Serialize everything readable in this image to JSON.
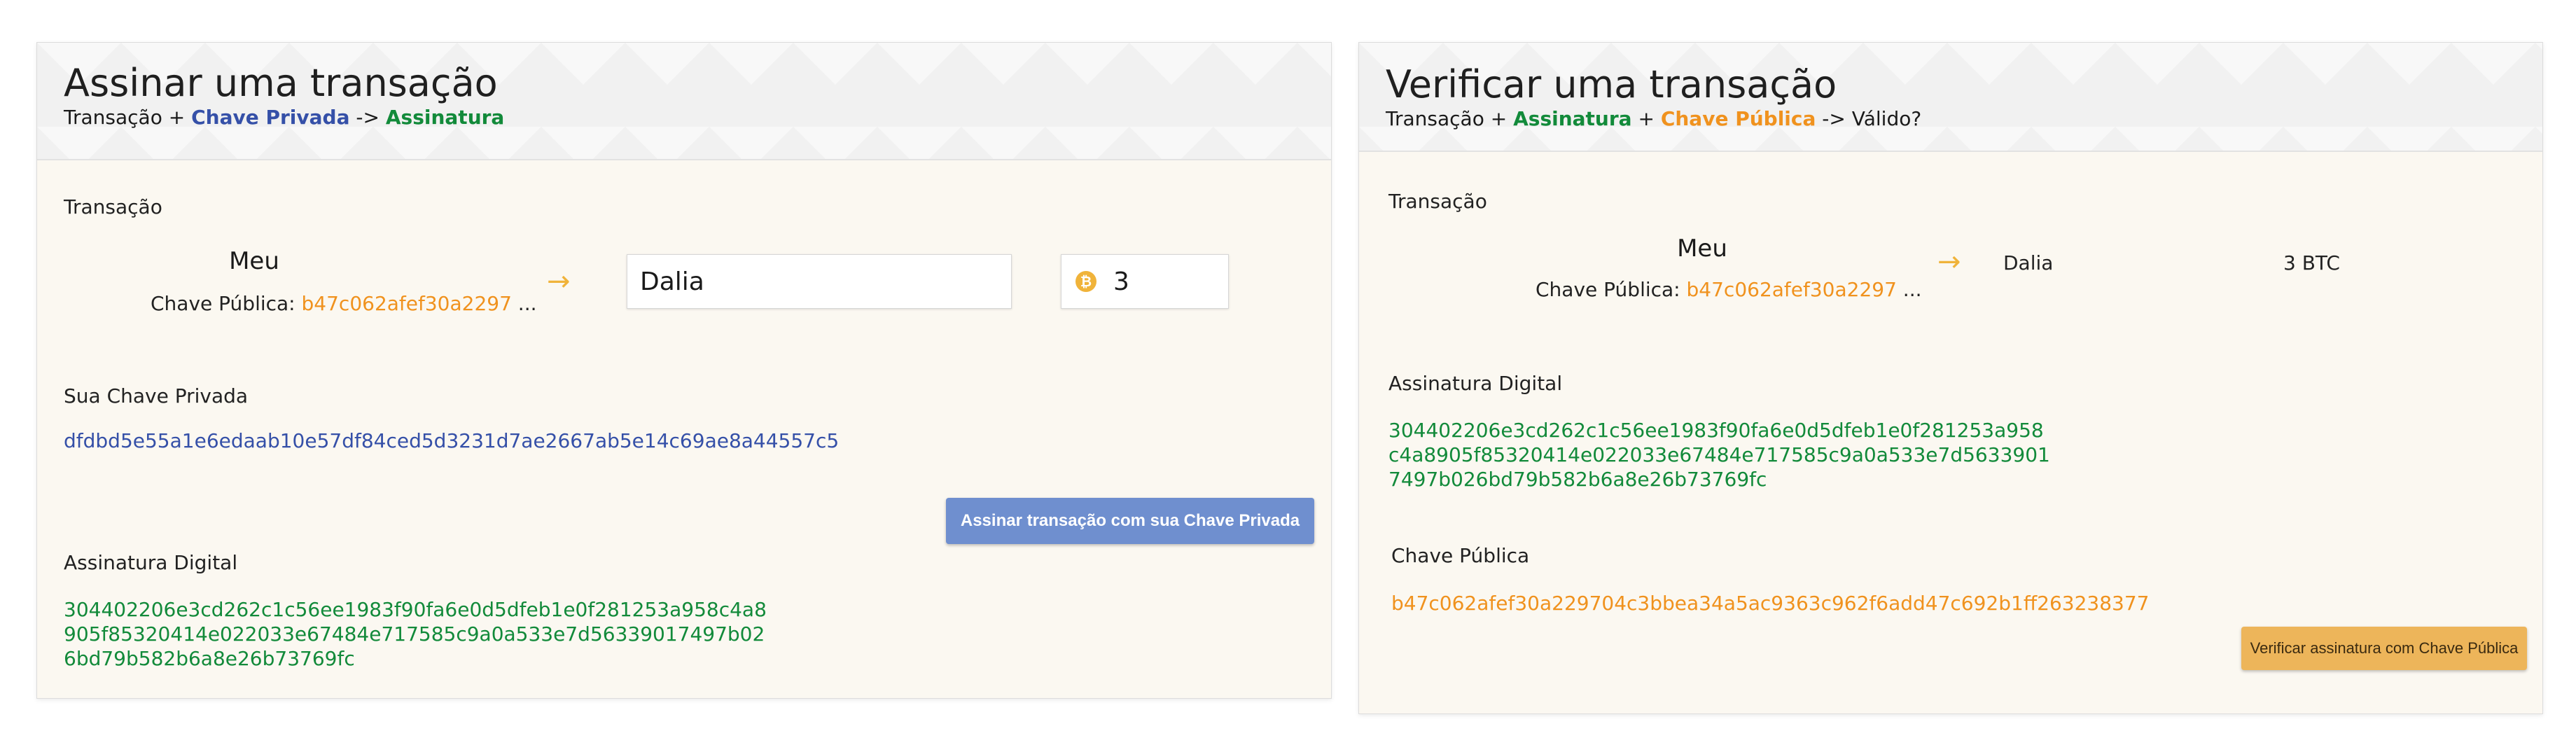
{
  "sign": {
    "title": "Assinar uma transação",
    "subtitle": {
      "part1": "Transação + ",
      "private_key": "Chave Privada",
      "part2": " -> ",
      "signature": "Assinatura"
    },
    "transaction_label": "Transação",
    "from_name": "Meu",
    "public_key_label": "Chave Pública: ",
    "public_key_short": "b47c062afef30a2297",
    "ellipsis": " ...",
    "arrow": "→",
    "to_value": "Dalia",
    "amount_value": "3",
    "coin_glyph": "₿",
    "private_key_label": "Sua Chave Privada",
    "private_key_value": "dfdbd5e55a1e6edaab10e57df84ced5d3231d7ae2667ab5e14c69ae8a44557c5",
    "sign_button": "Assinar transação com sua Chave Privada",
    "signature_label": "Assinatura Digital",
    "signature_value": "304402206e3cd262c1c56ee1983f90fa6e0d5dfeb1e0f281253a958c4a8\n905f85320414e022033e67484e717585c9a0a533e7d56339017497b02\n6bd79b582b6a8e26b73769fc"
  },
  "verify": {
    "title": "Verificar uma transação",
    "subtitle": {
      "part1": "Transação + ",
      "signature": "Assinatura",
      "part2": " + ",
      "public_key": "Chave Pública",
      "part3": " -> Válido?"
    },
    "transaction_label": "Transação",
    "from_name": "Meu",
    "public_key_label": "Chave Pública: ",
    "public_key_short": "b47c062afef30a2297",
    "ellipsis": " ...",
    "arrow": "→",
    "to_value": "Dalia",
    "amount_value": "3 BTC",
    "signature_label": "Assinatura Digital",
    "signature_value": "304402206e3cd262c1c56ee1983f90fa6e0d5dfeb1e0f281253a958\nc4a8905f85320414e022033e67484e717585c9a0a533e7d5633901\n7497b026bd79b582b6a8e26b73769fc",
    "public_key_section_label": "Chave Pública",
    "public_key_full": "b47c062afef30a229704c3bbea34a5ac9363c962f6add47c692b1ff263238377",
    "verify_button": "Verificar assinatura com Chave Pública"
  },
  "colors": {
    "private_key": "#3550a8",
    "signature": "#128a3a",
    "public_key": "#f0921e",
    "sign_button_bg": "#6f8fcf",
    "verify_button_bg": "#edb55a",
    "panel_bg": "#fbf8f1"
  }
}
